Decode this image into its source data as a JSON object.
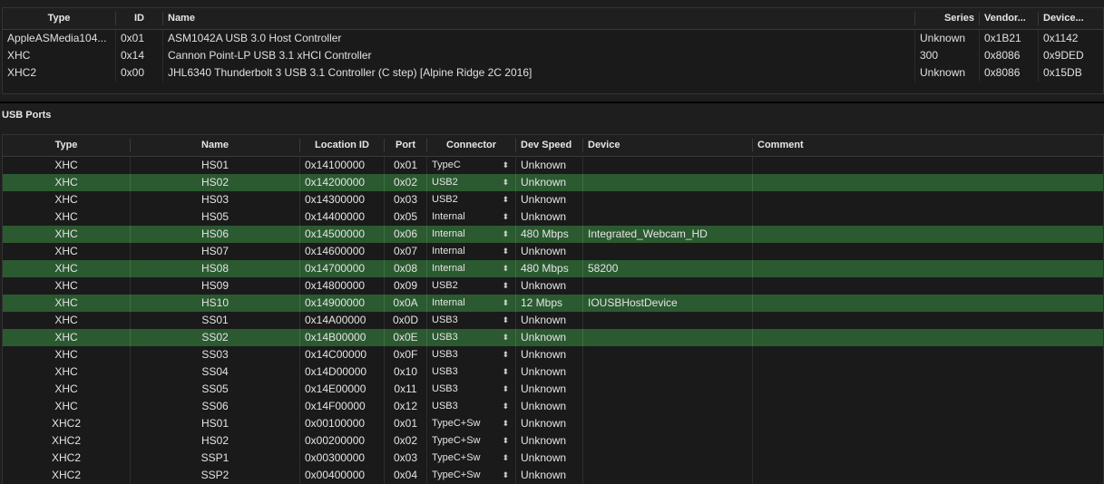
{
  "controllers": {
    "headers": [
      "Type",
      "ID",
      "Name",
      "Series",
      "Vendor...",
      "Device..."
    ],
    "rows": [
      {
        "type": "AppleASMedia104...",
        "id": "0x01",
        "name": "ASM1042A USB 3.0 Host Controller",
        "series": "Unknown",
        "vendor": "0x1B21",
        "device": "0x1142"
      },
      {
        "type": "XHC",
        "id": "0x14",
        "name": "Cannon Point-LP USB 3.1 xHCI Controller",
        "series": "300",
        "vendor": "0x8086",
        "device": "0x9DED"
      },
      {
        "type": "XHC2",
        "id": "0x00",
        "name": "JHL6340 Thunderbolt 3 USB 3.1 Controller (C step) [Alpine Ridge 2C 2016]",
        "series": "Unknown",
        "vendor": "0x8086",
        "device": "0x15DB"
      }
    ]
  },
  "usb_ports": {
    "title": "USB Ports",
    "headers": [
      "Type",
      "Name",
      "Location ID",
      "Port",
      "Connector",
      "Dev Speed",
      "Device",
      "Comment"
    ],
    "highlight_color": "#2b5a31",
    "rows": [
      {
        "type": "XHC",
        "name": "HS01",
        "location": "0x14100000",
        "port": "0x01",
        "connector": "TypeC",
        "speed": "Unknown",
        "device": "",
        "comment": "",
        "active": false
      },
      {
        "type": "XHC",
        "name": "HS02",
        "location": "0x14200000",
        "port": "0x02",
        "connector": "USB2",
        "speed": "Unknown",
        "device": "",
        "comment": "",
        "active": true
      },
      {
        "type": "XHC",
        "name": "HS03",
        "location": "0x14300000",
        "port": "0x03",
        "connector": "USB2",
        "speed": "Unknown",
        "device": "",
        "comment": "",
        "active": false
      },
      {
        "type": "XHC",
        "name": "HS05",
        "location": "0x14400000",
        "port": "0x05",
        "connector": "Internal",
        "speed": "Unknown",
        "device": "",
        "comment": "",
        "active": false
      },
      {
        "type": "XHC",
        "name": "HS06",
        "location": "0x14500000",
        "port": "0x06",
        "connector": "Internal",
        "speed": "480 Mbps",
        "device": "Integrated_Webcam_HD",
        "comment": "",
        "active": true
      },
      {
        "type": "XHC",
        "name": "HS07",
        "location": "0x14600000",
        "port": "0x07",
        "connector": "Internal",
        "speed": "Unknown",
        "device": "",
        "comment": "",
        "active": false
      },
      {
        "type": "XHC",
        "name": "HS08",
        "location": "0x14700000",
        "port": "0x08",
        "connector": "Internal",
        "speed": "480 Mbps",
        "device": "58200",
        "comment": "",
        "active": true
      },
      {
        "type": "XHC",
        "name": "HS09",
        "location": "0x14800000",
        "port": "0x09",
        "connector": "USB2",
        "speed": "Unknown",
        "device": "",
        "comment": "",
        "active": false
      },
      {
        "type": "XHC",
        "name": "HS10",
        "location": "0x14900000",
        "port": "0x0A",
        "connector": "Internal",
        "speed": "12 Mbps",
        "device": "IOUSBHostDevice",
        "comment": "",
        "active": true
      },
      {
        "type": "XHC",
        "name": "SS01",
        "location": "0x14A00000",
        "port": "0x0D",
        "connector": "USB3",
        "speed": "Unknown",
        "device": "",
        "comment": "",
        "active": false
      },
      {
        "type": "XHC",
        "name": "SS02",
        "location": "0x14B00000",
        "port": "0x0E",
        "connector": "USB3",
        "speed": "Unknown",
        "device": "",
        "comment": "",
        "active": true
      },
      {
        "type": "XHC",
        "name": "SS03",
        "location": "0x14C00000",
        "port": "0x0F",
        "connector": "USB3",
        "speed": "Unknown",
        "device": "",
        "comment": "",
        "active": false
      },
      {
        "type": "XHC",
        "name": "SS04",
        "location": "0x14D00000",
        "port": "0x10",
        "connector": "USB3",
        "speed": "Unknown",
        "device": "",
        "comment": "",
        "active": false
      },
      {
        "type": "XHC",
        "name": "SS05",
        "location": "0x14E00000",
        "port": "0x11",
        "connector": "USB3",
        "speed": "Unknown",
        "device": "",
        "comment": "",
        "active": false
      },
      {
        "type": "XHC",
        "name": "SS06",
        "location": "0x14F00000",
        "port": "0x12",
        "connector": "USB3",
        "speed": "Unknown",
        "device": "",
        "comment": "",
        "active": false
      },
      {
        "type": "XHC2",
        "name": "HS01",
        "location": "0x00100000",
        "port": "0x01",
        "connector": "TypeC+Sw",
        "speed": "Unknown",
        "device": "",
        "comment": "",
        "active": false
      },
      {
        "type": "XHC2",
        "name": "HS02",
        "location": "0x00200000",
        "port": "0x02",
        "connector": "TypeC+Sw",
        "speed": "Unknown",
        "device": "",
        "comment": "",
        "active": false
      },
      {
        "type": "XHC2",
        "name": "SSP1",
        "location": "0x00300000",
        "port": "0x03",
        "connector": "TypeC+Sw",
        "speed": "Unknown",
        "device": "",
        "comment": "",
        "active": false
      },
      {
        "type": "XHC2",
        "name": "SSP2",
        "location": "0x00400000",
        "port": "0x04",
        "connector": "TypeC+Sw",
        "speed": "Unknown",
        "device": "",
        "comment": "",
        "active": false
      }
    ]
  }
}
